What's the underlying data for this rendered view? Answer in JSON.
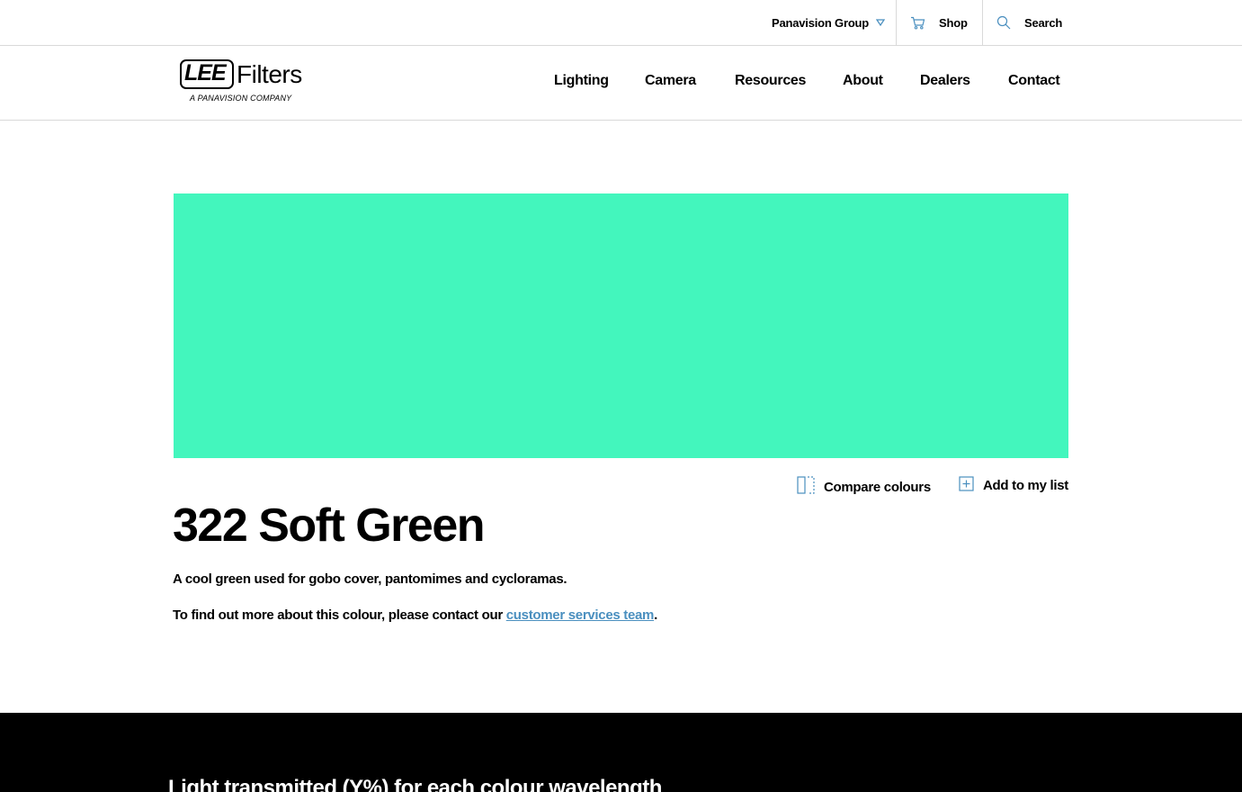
{
  "utility": {
    "group_label": "Panavision Group",
    "shop_label": "Shop",
    "search_label": "Search",
    "accent_color": "#4a8fbf"
  },
  "logo": {
    "lee": "LEE",
    "filters": "Filters",
    "subtitle": "A PANAVISION COMPANY"
  },
  "nav": {
    "items": [
      "Lighting",
      "Camera",
      "Resources",
      "About",
      "Dealers",
      "Contact"
    ]
  },
  "swatch": {
    "color": "#43f6bd"
  },
  "actions": {
    "compare_label": "Compare colours",
    "add_label": "Add to my list"
  },
  "product": {
    "title": "322 Soft Green",
    "description": "A cool green used for gobo cover, pantomimes and cycloramas.",
    "contact_prefix": "To find out more about this colour, please contact our ",
    "contact_link": "customer services team",
    "contact_suffix": "."
  },
  "band": {
    "title": "Light transmitted (Y%) for each colour wavelength"
  }
}
